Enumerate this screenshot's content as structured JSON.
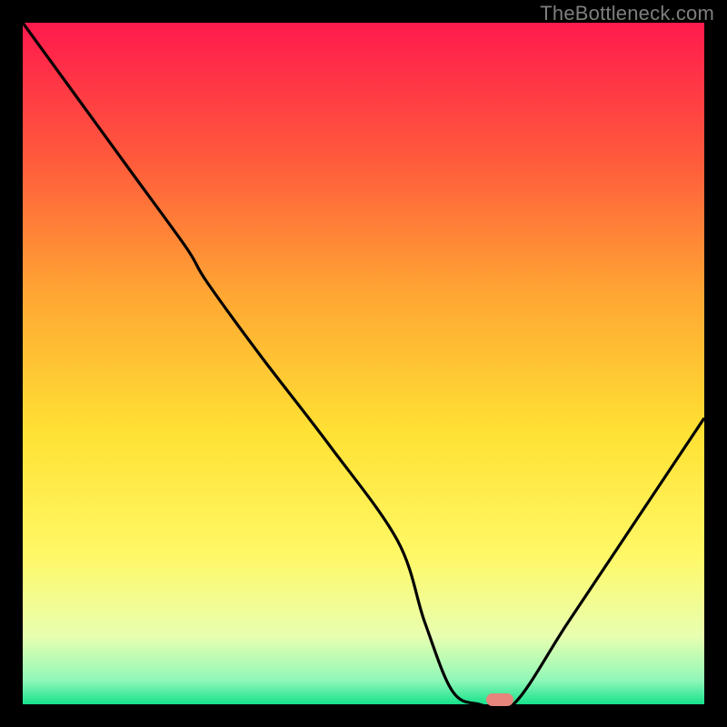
{
  "watermark": "TheBottleneck.com",
  "colors": {
    "frame_bg": "#000000",
    "watermark_text": "#7e7e7e",
    "gradient_stops": [
      {
        "offset": 0.0,
        "color": "#ff1a4d"
      },
      {
        "offset": 0.2,
        "color": "#ff5a3c"
      },
      {
        "offset": 0.4,
        "color": "#ffa733"
      },
      {
        "offset": 0.6,
        "color": "#ffe133"
      },
      {
        "offset": 0.78,
        "color": "#fff866"
      },
      {
        "offset": 0.9,
        "color": "#e8ffb0"
      },
      {
        "offset": 0.965,
        "color": "#90f7b8"
      },
      {
        "offset": 1.0,
        "color": "#17e28c"
      }
    ],
    "curve_stroke": "#000000",
    "marker_fill": "#e5857b"
  },
  "chart_data": {
    "type": "line",
    "title": "",
    "xlabel": "",
    "ylabel": "",
    "xlim": [
      0,
      100
    ],
    "ylim": [
      0,
      100
    ],
    "series": [
      {
        "name": "bottleneck-curve",
        "x": [
          0,
          8,
          16,
          24,
          27,
          35,
          45,
          55,
          59,
          63,
          67,
          72,
          80,
          90,
          100
        ],
        "y": [
          100,
          89,
          78,
          67,
          62,
          51,
          38,
          24,
          12,
          2,
          0,
          0,
          12,
          27,
          42
        ]
      }
    ],
    "annotations": [
      {
        "name": "optimal-marker",
        "x": 70,
        "y": 0
      }
    ],
    "legend": false,
    "grid": false
  }
}
